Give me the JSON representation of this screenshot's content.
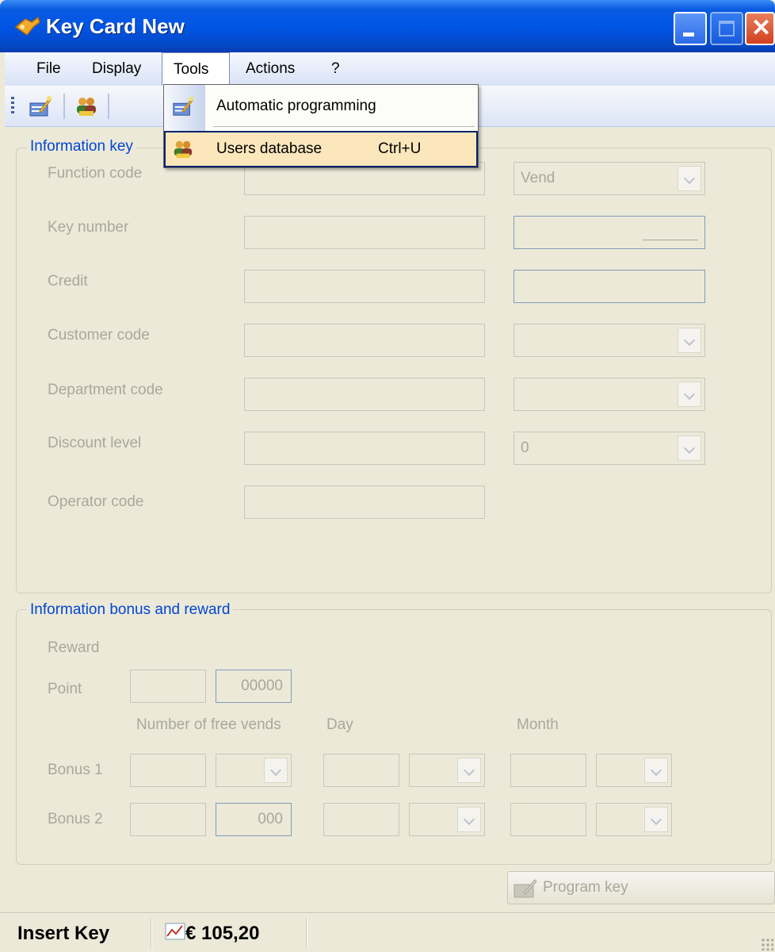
{
  "window": {
    "title": "Key Card New"
  },
  "menubar": {
    "items": [
      {
        "label": "File"
      },
      {
        "label": "Display"
      },
      {
        "label": "Tools"
      },
      {
        "label": "Actions"
      },
      {
        "label": "?"
      }
    ]
  },
  "tools_menu": {
    "items": [
      {
        "label": "Automatic programming",
        "shortcut": "",
        "icon": "auto-program-icon"
      },
      {
        "label": "Users database",
        "shortcut": "Ctrl+U",
        "icon": "users-database-icon",
        "highlighted": true
      }
    ]
  },
  "info_key": {
    "title": "Information key",
    "labels": {
      "function_code": "Function code",
      "key_number": "Key number",
      "credit": "Credit",
      "customer_code": "Customer code",
      "department_code": "Department code",
      "discount_level": "Discount level",
      "operator_code": "Operator code"
    },
    "function_combo_value": "Vend",
    "discount_combo_value": "0"
  },
  "bonus_reward": {
    "title": "Information bonus and reward",
    "reward_label": "Reward",
    "point_label": "Point",
    "point_value": "00000",
    "col_free_vends": "Number of free vends",
    "col_day": "Day",
    "col_month": "Month",
    "bonus1_label": "Bonus 1",
    "bonus2_label": "Bonus 2",
    "bonus2_vends_value": "000"
  },
  "program_button": {
    "label": "Program key"
  },
  "statusbar": {
    "status": "Insert Key",
    "credit": "€ 105,20"
  },
  "colors": {
    "titlebar": "#0055E5",
    "group_title": "#0046D5",
    "menu_highlight": "#FCE7BC",
    "disabled_text": "#A9A899"
  }
}
